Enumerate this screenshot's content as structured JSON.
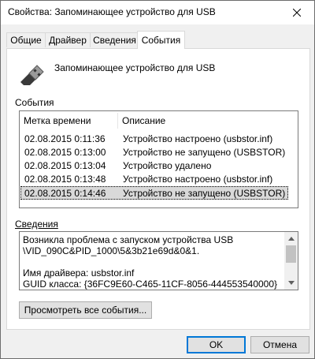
{
  "window": {
    "title": "Свойства: Запоминающее устройство для USB"
  },
  "tabs": [
    {
      "label": "Общие"
    },
    {
      "label": "Драйвер"
    },
    {
      "label": "Сведения"
    },
    {
      "label": "События",
      "active": true
    }
  ],
  "device": {
    "name": "Запоминающее устройство для USB",
    "icon": "usb-device-icon"
  },
  "events": {
    "label": "События",
    "columns": [
      "Метка времени",
      "Описание"
    ],
    "rows": [
      {
        "time": "02.08.2015 0:11:36",
        "desc": "Устройство настроено (usbstor.inf)"
      },
      {
        "time": "02.08.2015 0:13:00",
        "desc": "Устройство не запущено (USBSTOR)"
      },
      {
        "time": "02.08.2015 0:13:04",
        "desc": "Устройство удалено"
      },
      {
        "time": "02.08.2015 0:13:48",
        "desc": "Устройство настроено (usbstor.inf)"
      },
      {
        "time": "02.08.2015 0:14:46",
        "desc": "Устройство не запущено (USBSTOR)",
        "selected": true
      }
    ]
  },
  "details": {
    "label": "Сведения",
    "lines": [
      "Возникла проблема с запуском устройства USB",
      "\\VID_090C&PID_1000\\5&3b21e69d&0&1.",
      "",
      "Имя драйвера: usbstor.inf",
      "GUID класса: {36FC9E60-C465-11CF-8056-444553540000}"
    ]
  },
  "buttons": {
    "view_all": "Просмотреть все события...",
    "ok": "OK",
    "cancel": "Отмена"
  }
}
